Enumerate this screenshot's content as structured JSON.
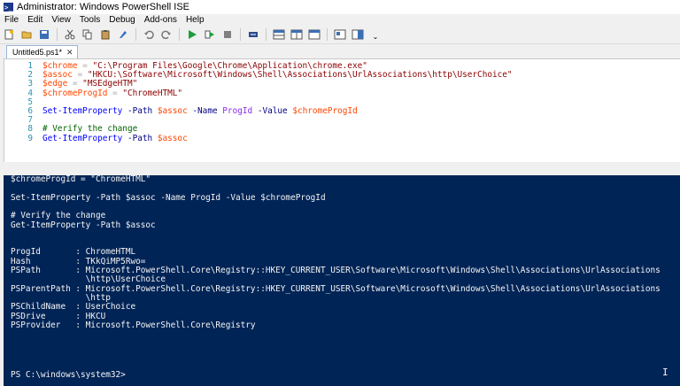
{
  "window": {
    "title": "Administrator: Windows PowerShell ISE"
  },
  "menu": [
    "File",
    "Edit",
    "View",
    "Tools",
    "Debug",
    "Add-ons",
    "Help"
  ],
  "toolbar": {
    "icons": [
      "new-file-icon",
      "open-folder-icon",
      "save-icon",
      "cut-icon",
      "copy-icon",
      "paste-icon",
      "clear-icon",
      "undo-icon",
      "redo-icon",
      "run-icon",
      "run-selection-icon",
      "stop-icon",
      "remote-icon",
      "layout-top-icon",
      "layout-right-icon",
      "layout-max-icon",
      "show-commands-icon",
      "show-addon-icon"
    ]
  },
  "tab": {
    "label": "Untitled5.ps1*",
    "close": "✕"
  },
  "editor": {
    "lines": [
      {
        "n": "1",
        "segs": [
          [
            "var",
            "$chrome"
          ],
          [
            "op",
            " = "
          ],
          [
            "str",
            "\"C:\\Program Files\\Google\\Chrome\\Application\\chrome.exe\""
          ]
        ]
      },
      {
        "n": "2",
        "segs": [
          [
            "var",
            "$assoc"
          ],
          [
            "op",
            " = "
          ],
          [
            "str",
            "\"HKCU:\\Software\\Microsoft\\Windows\\Shell\\Associations\\UrlAssociations\\http\\UserChoice\""
          ]
        ]
      },
      {
        "n": "3",
        "segs": [
          [
            "var",
            "$edge"
          ],
          [
            "op",
            " = "
          ],
          [
            "str",
            "\"MSEdgeHTM\""
          ]
        ]
      },
      {
        "n": "4",
        "segs": [
          [
            "var",
            "$chromeProgId"
          ],
          [
            "op",
            " = "
          ],
          [
            "str",
            "\"ChromeHTML\""
          ]
        ]
      },
      {
        "n": "5",
        "segs": []
      },
      {
        "n": "6",
        "segs": [
          [
            "cmd",
            "Set-ItemProperty"
          ],
          [
            "op",
            " "
          ],
          [
            "param",
            "-Path"
          ],
          [
            "op",
            " "
          ],
          [
            "var",
            "$assoc"
          ],
          [
            "op",
            " "
          ],
          [
            "param",
            "-Name"
          ],
          [
            "op",
            " "
          ],
          [
            "arg",
            "ProgId"
          ],
          [
            "op",
            " "
          ],
          [
            "param",
            "-Value"
          ],
          [
            "op",
            " "
          ],
          [
            "var",
            "$chromeProgId"
          ]
        ]
      },
      {
        "n": "7",
        "segs": []
      },
      {
        "n": "8",
        "segs": [
          [
            "cmt",
            "# Verify the change"
          ]
        ]
      },
      {
        "n": "9",
        "segs": [
          [
            "cmd",
            "Get-ItemProperty"
          ],
          [
            "op",
            " "
          ],
          [
            "param",
            "-Path"
          ],
          [
            "op",
            " "
          ],
          [
            "var",
            "$assoc"
          ]
        ]
      }
    ]
  },
  "console": {
    "lines": [
      "$chromeProgId = \"ChromeHTML\"",
      "",
      "Set-ItemProperty -Path $assoc -Name ProgId -Value $chromeProgId",
      "",
      "# Verify the change",
      "Get-ItemProperty -Path $assoc",
      "",
      "",
      "ProgId       : ChromeHTML",
      "Hash         : TKkQiMP5Rwo=",
      "PSPath       : Microsoft.PowerShell.Core\\Registry::HKEY_CURRENT_USER\\Software\\Microsoft\\Windows\\Shell\\Associations\\UrlAssociations",
      "               \\http\\UserChoice",
      "PSParentPath : Microsoft.PowerShell.Core\\Registry::HKEY_CURRENT_USER\\Software\\Microsoft\\Windows\\Shell\\Associations\\UrlAssociations",
      "               \\http",
      "PSChildName  : UserChoice",
      "PSDrive      : HKCU",
      "PSProvider   : Microsoft.PowerShell.Core\\Registry"
    ],
    "prompt": "PS C:\\windows\\system32>"
  },
  "colors": {
    "console_bg": "#012456",
    "variable": "#ff4500",
    "string": "#8b0000",
    "command": "#0000ff",
    "comment": "#006400",
    "line_number": "#2b91af"
  }
}
